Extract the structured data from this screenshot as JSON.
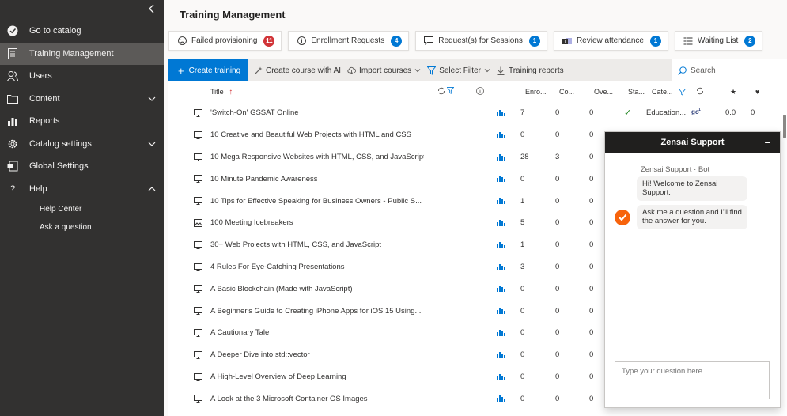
{
  "sidebar": {
    "items": [
      {
        "label": "Go to catalog",
        "icon": "catalog-check-icon"
      },
      {
        "label": "Training Management",
        "icon": "training-icon"
      },
      {
        "label": "Users",
        "icon": "users-icon"
      },
      {
        "label": "Content",
        "icon": "folder-icon"
      },
      {
        "label": "Reports",
        "icon": "chart-icon"
      },
      {
        "label": "Catalog settings",
        "icon": "gear-icon"
      },
      {
        "label": "Global Settings",
        "icon": "global-settings-icon"
      },
      {
        "label": "Help",
        "icon": "question-icon"
      }
    ],
    "help_sub": [
      "Help Center",
      "Ask a question"
    ]
  },
  "page": {
    "title": "Training Management"
  },
  "cards": [
    {
      "label": "Failed provisioning",
      "count": "11",
      "color": "#d13438"
    },
    {
      "label": "Enrollment Requests",
      "count": "4",
      "color": "#0078d4"
    },
    {
      "label": "Request(s) for Sessions",
      "count": "1",
      "color": "#0078d4"
    },
    {
      "label": "Review attendance",
      "count": "1",
      "color": "#0078d4"
    },
    {
      "label": "Waiting List",
      "count": "2",
      "color": "#0078d4"
    }
  ],
  "toolbar": {
    "create": "Create training",
    "create_ai": "Create course with AI",
    "import": "Import courses",
    "filter": "Select Filter",
    "reports": "Training reports",
    "search_placeholder": "Search"
  },
  "grid": {
    "headers": {
      "title": "Title",
      "enrolled": "Enro...",
      "completed": "Co...",
      "overdue": "Ove...",
      "status": "Sta...",
      "category": "Cate...",
      "rating": "★",
      "likes": "♥"
    },
    "rows": [
      {
        "title": "'Switch-On' GSSAT Online",
        "enrolled": "7",
        "completed": "0",
        "overdue": "0",
        "status": "✓",
        "category": "Education...",
        "rating": "0.0",
        "likes": "0"
      },
      {
        "title": "10 Creative and Beautiful Web Projects with HTML and CSS",
        "enrolled": "0",
        "completed": "0",
        "overdue": "0"
      },
      {
        "title": "10 Mega Responsive Websites with HTML, CSS, and JavaScript",
        "enrolled": "28",
        "completed": "3",
        "overdue": "0"
      },
      {
        "title": "10 Minute Pandemic Awareness",
        "enrolled": "0",
        "completed": "0",
        "overdue": "0"
      },
      {
        "title": "10 Tips for Effective Speaking for Business Owners - Public S...",
        "enrolled": "1",
        "completed": "0",
        "overdue": "0"
      },
      {
        "title": "100 Meeting Icebreakers",
        "enrolled": "5",
        "completed": "0",
        "overdue": "0"
      },
      {
        "title": "30+ Web Projects with HTML, CSS, and JavaScript",
        "enrolled": "1",
        "completed": "0",
        "overdue": "0"
      },
      {
        "title": "4 Rules For Eye-Catching Presentations",
        "enrolled": "3",
        "completed": "0",
        "overdue": "0"
      },
      {
        "title": "A Basic Blockchain (Made with JavaScript)",
        "enrolled": "0",
        "completed": "0",
        "overdue": "0"
      },
      {
        "title": "A Beginner's Guide to Creating iPhone Apps for iOS 15 Using...",
        "enrolled": "0",
        "completed": "0",
        "overdue": "0"
      },
      {
        "title": "A Cautionary Tale",
        "enrolled": "0",
        "completed": "0",
        "overdue": "0"
      },
      {
        "title": "A Deeper Dive into std::vector",
        "enrolled": "0",
        "completed": "0",
        "overdue": "0"
      },
      {
        "title": "A High-Level Overview of Deep Learning",
        "enrolled": "0",
        "completed": "0",
        "overdue": "0"
      },
      {
        "title": "A Look at the 3 Microsoft Container OS Images",
        "enrolled": "0",
        "completed": "0",
        "overdue": "0"
      }
    ]
  },
  "chat": {
    "title": "Zensai Support",
    "sender": "Zensai Support · Bot",
    "msg1": "Hi! Welcome to Zensai Support.",
    "msg2": "Ask me a question and I'll find the answer for you.",
    "placeholder": "Type your question here..."
  },
  "colors": {
    "sidebar": "#323130",
    "accent": "#0078d4",
    "alert": "#d13438",
    "bot": "#f7630c"
  }
}
